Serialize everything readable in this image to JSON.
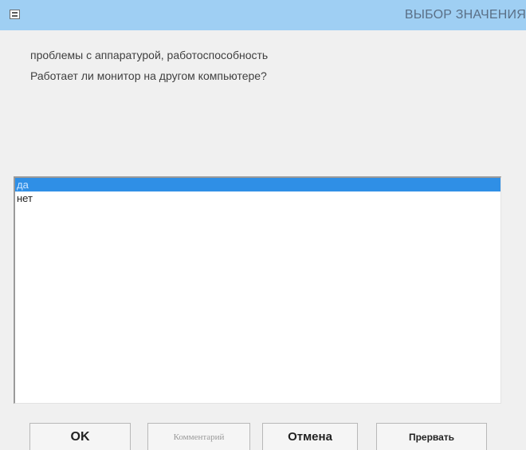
{
  "window": {
    "title": "ВЫБОР ЗНАЧЕНИЯ",
    "title_bar_color": "#9fcff3",
    "app_icon": "window-app-icon"
  },
  "question": {
    "category": "проблемы с аппаратурой, работоспособность",
    "text": "Работает ли монитор на другом компьютере?"
  },
  "options": [
    {
      "label": "да",
      "selected": true
    },
    {
      "label": "нет",
      "selected": false
    }
  ],
  "selection_color": "#2f8fe6",
  "buttons": {
    "ok": "OK",
    "comment": "Комментарий",
    "cancel": "Отмена",
    "abort": "Прервать"
  }
}
